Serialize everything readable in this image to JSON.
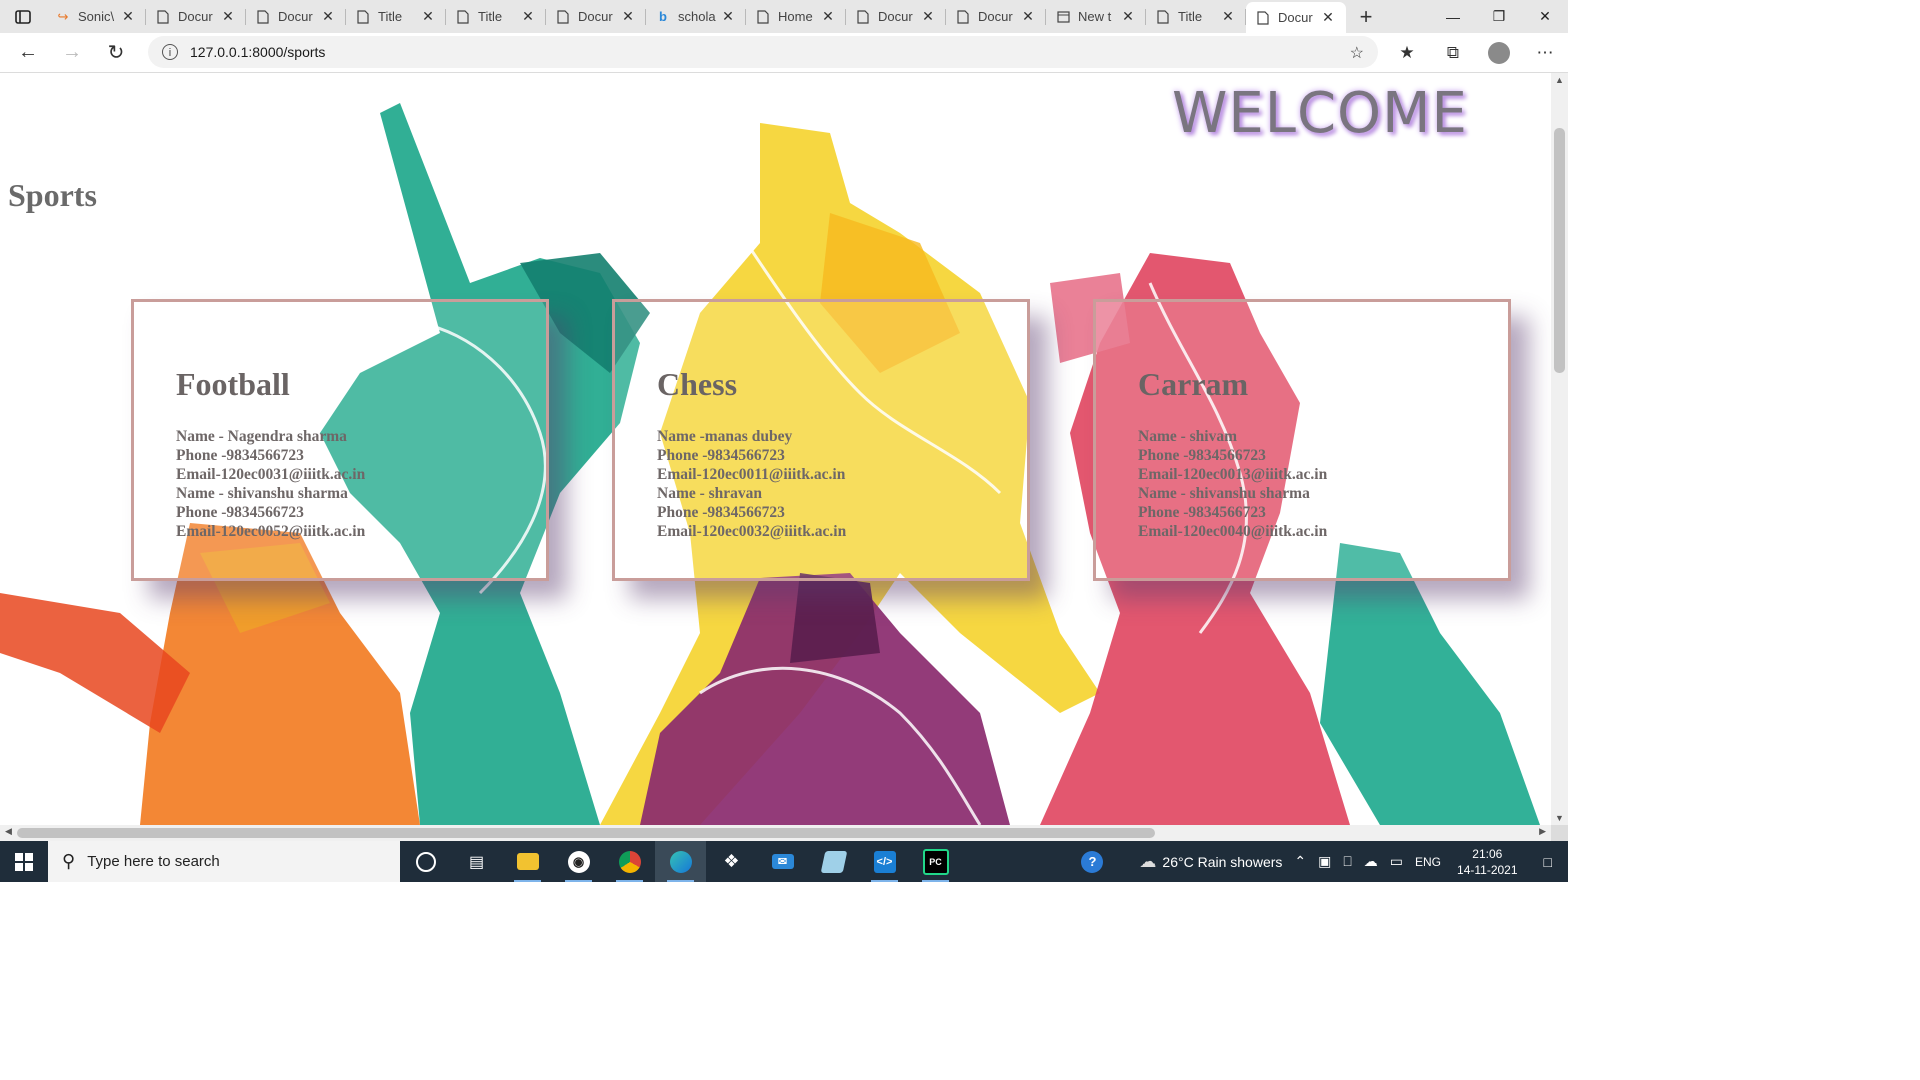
{
  "browser": {
    "tabs": [
      {
        "label": "Sonic\\",
        "icon": "sonic-icon",
        "active": false
      },
      {
        "label": "Docur",
        "icon": "page-icon",
        "active": false
      },
      {
        "label": "Docur",
        "icon": "page-icon",
        "active": false
      },
      {
        "label": "Title",
        "icon": "page-icon",
        "active": false
      },
      {
        "label": "Title",
        "icon": "page-icon",
        "active": false
      },
      {
        "label": "Docur",
        "icon": "page-icon",
        "active": false
      },
      {
        "label": "schola",
        "icon": "bing-icon",
        "active": false
      },
      {
        "label": "Home",
        "icon": "page-icon",
        "active": false
      },
      {
        "label": "Docur",
        "icon": "page-icon",
        "active": false
      },
      {
        "label": "Docur",
        "icon": "page-icon",
        "active": false
      },
      {
        "label": "New t",
        "icon": "newtab-icon",
        "active": false
      },
      {
        "label": "Title",
        "icon": "page-icon",
        "active": false
      },
      {
        "label": "Docur",
        "icon": "page-icon",
        "active": true
      }
    ],
    "url": "127.0.0.1:8000/sports"
  },
  "page": {
    "welcome": "WELCOME",
    "title": "Sports",
    "cards": [
      {
        "heading": "Football",
        "lines": [
          "Name - Nagendra sharma",
          "Phone -9834566723",
          "Email-120ec0031@iiitk.ac.in",
          "Name - shivanshu sharma",
          "Phone -9834566723",
          "Email-120ec0052@iiitk.ac.in"
        ]
      },
      {
        "heading": "Chess",
        "lines": [
          "Name -manas dubey",
          "Phone -9834566723",
          "Email-120ec0011@iiitk.ac.in",
          "Name - shravan",
          "Phone -9834566723",
          "Email-120ec0032@iiitk.ac.in"
        ]
      },
      {
        "heading": "Carram",
        "lines": [
          "Name - shivam",
          "Phone -9834566723",
          "Email-120ec0013@iiitk.ac.in",
          "Name - shivanshu sharma",
          "Phone -9834566723",
          "Email-120ec0040@iiitk.ac.in"
        ]
      }
    ]
  },
  "taskbar": {
    "search_placeholder": "Type here to search",
    "weather": "26°C  Rain showers",
    "language": "ENG",
    "time": "21:06",
    "date": "14-11-2021",
    "pinned": [
      "cortana-icon",
      "task-view-icon",
      "file-explorer-icon",
      "github-icon",
      "chrome-icon",
      "edge-icon",
      "dropbox-icon",
      "mail-icon",
      "notepad-icon",
      "vscode-icon",
      "pycharm-icon"
    ]
  },
  "colors": {
    "card_border": "#c99d9a",
    "welcome_glow": "#b88de0",
    "taskbar": "#1f2d3a"
  }
}
